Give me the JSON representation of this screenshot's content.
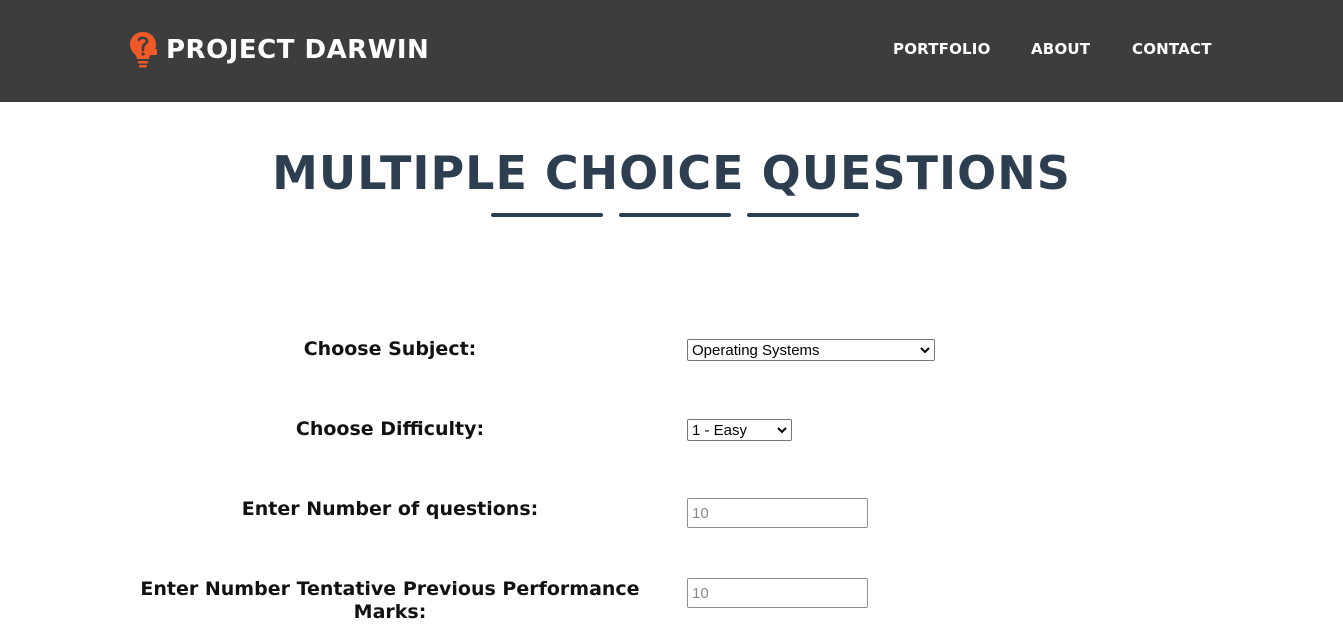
{
  "header": {
    "brand": "PROJECT DARWIN",
    "logo_icon": "lightbulb-logo-icon",
    "logo_color": "#f05a28",
    "background": "#3d3d3d",
    "nav": {
      "portfolio": "PORTFOLIO",
      "about": "ABOUT",
      "contact": "CONTACT"
    }
  },
  "main": {
    "title": "MULTIPLE CHOICE QUESTIONS",
    "title_color": "#2c3e50"
  },
  "form": {
    "subject": {
      "label": "Choose Subject:",
      "selected": "Operating Systems"
    },
    "difficulty": {
      "label": "Choose Difficulty:",
      "selected": "1 - Easy"
    },
    "question_count": {
      "label": "Enter Number of questions:",
      "placeholder": "10"
    },
    "previous_marks": {
      "label": "Enter Number Tentative Previous Performance Marks:",
      "placeholder": "10"
    }
  }
}
